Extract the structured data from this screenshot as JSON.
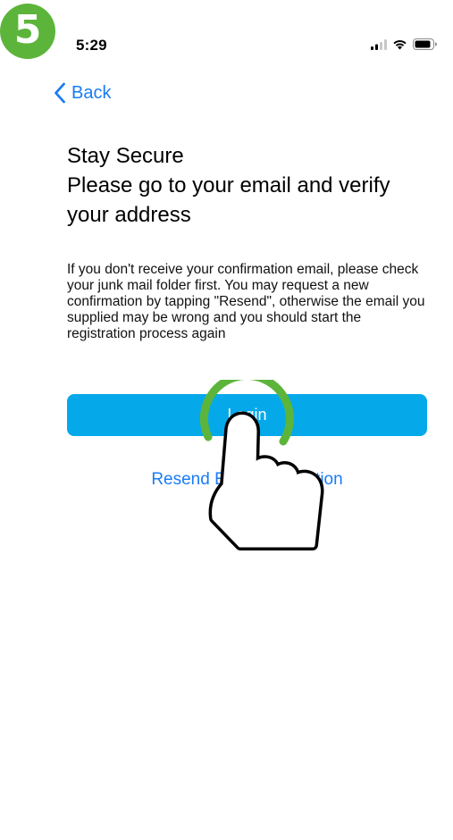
{
  "step": {
    "number": "5",
    "color": "#5cb53a"
  },
  "status_bar": {
    "time": "5:29",
    "icons": [
      "cellular-signal-icon",
      "wifi-icon",
      "battery-icon"
    ]
  },
  "nav": {
    "back_label": "Back",
    "accent_color": "#1a7cf6"
  },
  "headline": {
    "line1": "Stay Secure",
    "line2": "Please go to your email and verify",
    "line3": "your address"
  },
  "description": "If you don't receive your confirmation email, please check your junk mail folder first.  You may request a new confirmation by tapping \"Resend\", otherwise the email you supplied may be wrong and you should start the registration process again",
  "primary_button": {
    "label": "Login",
    "color": "#05a9ea"
  },
  "resend_link": {
    "label": "Resend Email verification"
  },
  "overlay": {
    "gesture": "tap-hand-icon"
  }
}
